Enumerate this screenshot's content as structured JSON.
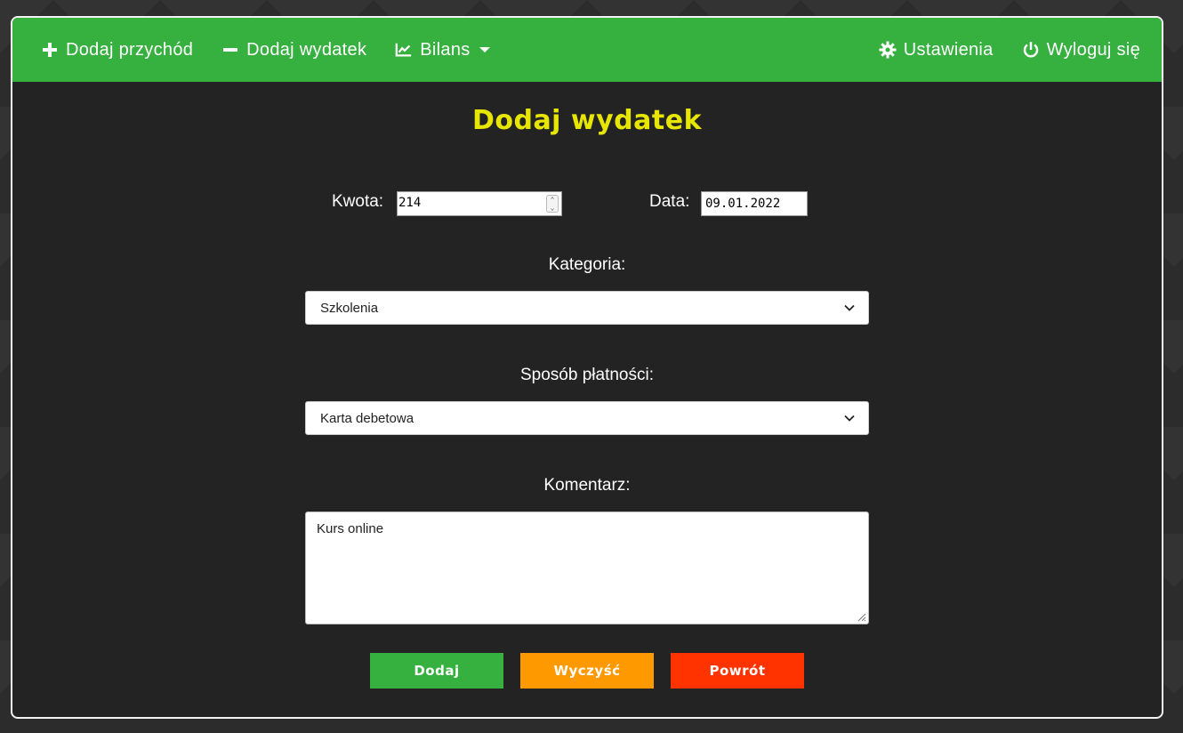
{
  "nav": {
    "add_income": "Dodaj przychód",
    "add_expense": "Dodaj wydatek",
    "balance": "Bilans",
    "settings": "Ustawienia",
    "logout": "Wyloguj się"
  },
  "page_title": "Dodaj wydatek",
  "form": {
    "amount_label": "Kwota:",
    "amount_value": "214",
    "date_label": "Data:",
    "date_value": "09.01.2022",
    "category_label": "Kategoria:",
    "category_value": "Szkolenia",
    "payment_label": "Sposób płatności:",
    "payment_value": "Karta debetowa",
    "comment_label": "Komentarz:",
    "comment_value": "Kurs online"
  },
  "buttons": {
    "add": "Dodaj",
    "clear": "Wyczyść",
    "back": "Powrót"
  },
  "colors": {
    "navbar": "#36b03f",
    "title": "#e6e600",
    "add_button": "#36b03f",
    "clear_button": "#ff9900",
    "back_button": "#ff3300"
  }
}
